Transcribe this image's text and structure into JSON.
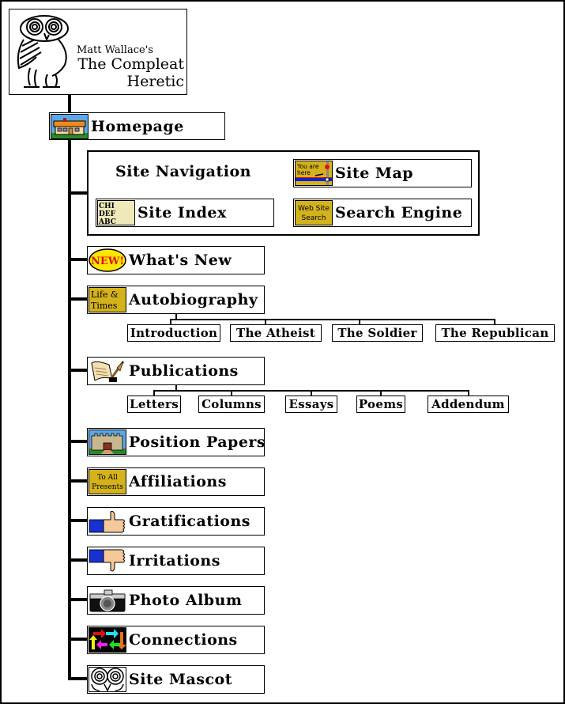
{
  "header": {
    "subtitle": "Matt Wallace's",
    "title_line1": "The Compleat",
    "title_line2": "Heretic",
    "logo_icon": "owl-logo-icon"
  },
  "homepage": {
    "label": "Homepage",
    "icon": "house-icon"
  },
  "site_navigation": {
    "title": "Site Navigation",
    "items": [
      {
        "label": "Site Map",
        "icon": "you-are-here-map-icon",
        "icon_text": [
          "You are",
          "here"
        ]
      },
      {
        "label": "Site Index",
        "icon": "alphabet-blocks-icon",
        "icon_text": [
          "CHI",
          "DEF",
          "ABC"
        ]
      },
      {
        "label": "Search Engine",
        "icon": "web-site-search-icon",
        "icon_text": [
          "Web Site",
          "Search"
        ]
      }
    ]
  },
  "menu": [
    {
      "label": "What's New",
      "icon": "new-badge-icon",
      "icon_text": "NEW!"
    },
    {
      "label": "Autobiography",
      "icon": "life-and-times-icon",
      "icon_text": [
        "Life &",
        "Times"
      ],
      "children": [
        "Introduction",
        "The Atheist",
        "The Soldier",
        "The Republican"
      ]
    },
    {
      "label": "Publications",
      "icon": "scroll-quill-icon",
      "children": [
        "Letters",
        "Columns",
        "Essays",
        "Poems",
        "Addendum"
      ]
    },
    {
      "label": "Position Papers",
      "icon": "castle-icon"
    },
    {
      "label": "Affiliations",
      "icon": "to-all-presents-icon",
      "icon_text": [
        "To All",
        "Presents"
      ]
    },
    {
      "label": "Gratifications",
      "icon": "thumbs-up-icon"
    },
    {
      "label": "Irritations",
      "icon": "thumbs-down-icon"
    },
    {
      "label": "Photo Album",
      "icon": "camera-icon"
    },
    {
      "label": "Connections",
      "icon": "colored-arrows-icon"
    },
    {
      "label": "Site Mascot",
      "icon": "owl-eyes-icon"
    }
  ],
  "colors": {
    "line": "#000000",
    "gold": "#d4b21c",
    "new_yellow": "#ffe600",
    "new_red": "#e01010",
    "blue_sleeve": "#1830d0",
    "skin": "#f4c89a",
    "sky": "#5aa8e8"
  }
}
